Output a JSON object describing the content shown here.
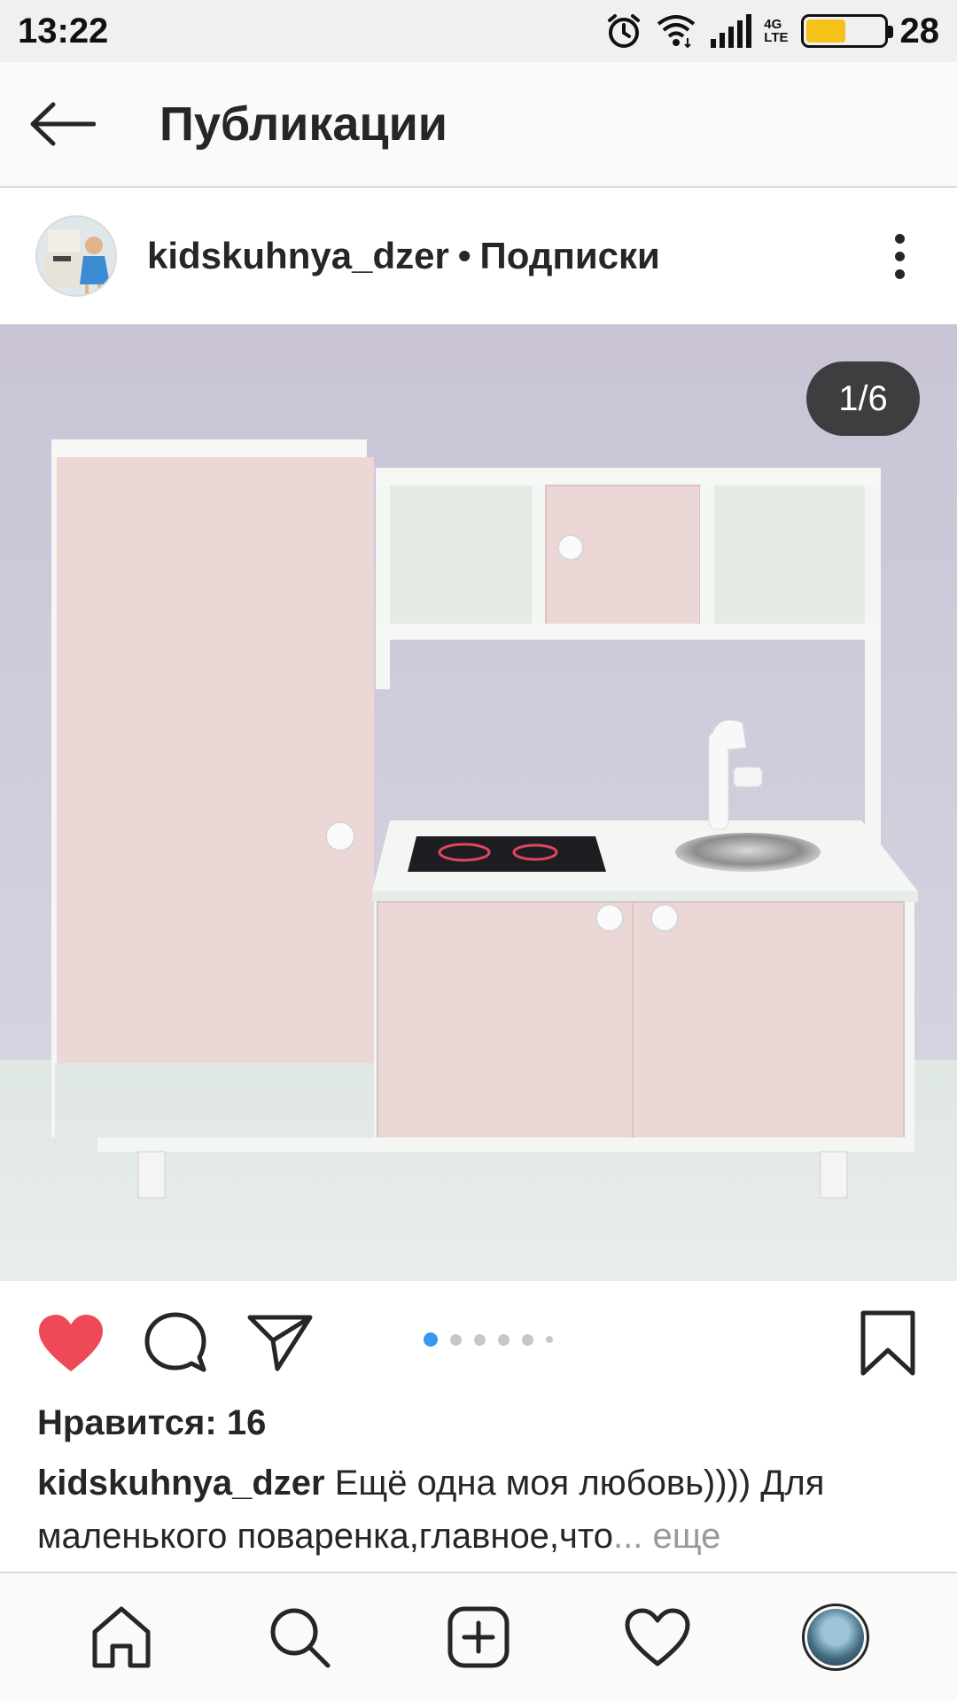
{
  "status_bar": {
    "time": "13:22",
    "network": "4G LTE",
    "battery_level": "28",
    "icons": [
      "alarm-icon",
      "wifi-icon",
      "signal-icon",
      "battery-icon"
    ]
  },
  "header": {
    "back_icon": "arrow-left-icon",
    "title": "Публикации"
  },
  "post": {
    "username": "kidskuhnya_dzer",
    "separator": "•",
    "follow_status": "Подписки",
    "more_icon": "more-vertical-icon",
    "photo_counter": "1/6",
    "carousel": {
      "count": 6,
      "active_index": 0
    },
    "liked": true,
    "likes_text": "Нравится: 16",
    "caption_user": "kidskuhnya_dzer",
    "caption_text": " Ещё одна моя любовь)))) Для маленького поваренка,главное,что",
    "caption_ellipsis": "...",
    "caption_more": " еще"
  },
  "actions": {
    "icons": [
      "heart-filled-icon",
      "comment-icon",
      "share-icon",
      "bookmark-icon"
    ]
  },
  "colors": {
    "like_red": "#ed4956",
    "carousel_active": "#3897f0",
    "text_primary": "#262626",
    "text_muted": "#999999"
  },
  "bottom_nav": {
    "items": [
      "home-icon",
      "search-icon",
      "add-post-icon",
      "activity-heart-icon",
      "profile-avatar"
    ]
  }
}
